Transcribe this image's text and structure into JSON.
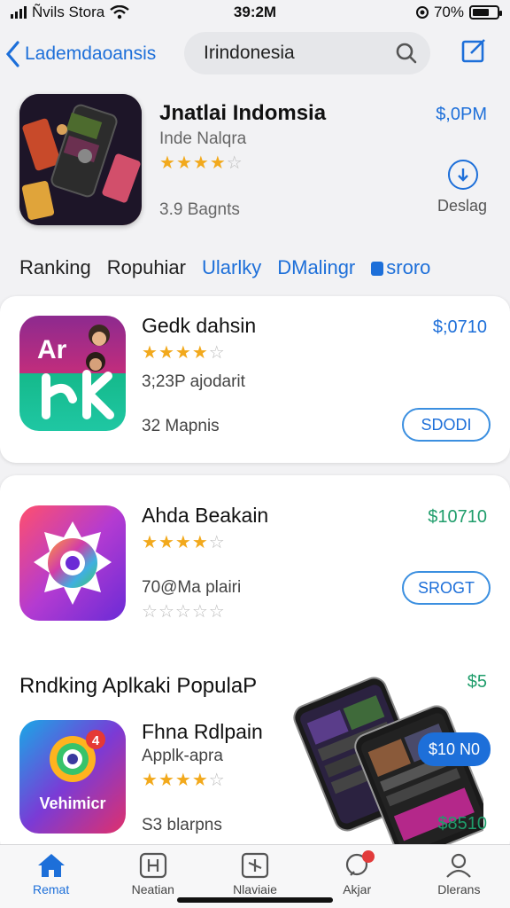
{
  "status_bar": {
    "carrier": "Ñvils Stora",
    "time": "39:2M",
    "battery": "70%",
    "battery_level": 0.7
  },
  "nav": {
    "back_label": "Lademdaoansis",
    "search_value": "Irindonesia"
  },
  "featured": {
    "title": "Jnatlai Indomsia",
    "subtitle": "Inde Nalqra",
    "rating": 3.5,
    "count": "3.9 Bagnts",
    "price": "$,0PM",
    "action_label": "Deslag"
  },
  "tabs": [
    "Ranking",
    "Ropuhiar",
    "Ularlky",
    "DMalingr",
    "sroro"
  ],
  "apps": [
    {
      "title": "Gedk dahsin",
      "rating": 4,
      "reviews": "3;23P ajodarit",
      "downloads": "32 Mapnis",
      "price": "$;0710",
      "button": "SDODI"
    },
    {
      "title": "Ahda Beakain",
      "rating": 4,
      "reviews": "70@Ma plairi",
      "rating2": 0,
      "price": "$10710",
      "button": "SROGT"
    }
  ],
  "section": {
    "title": "Rndking Aplkaki PopulaP",
    "price": "$5"
  },
  "bottom_app": {
    "title": "Fhna Rdlpain",
    "subtitle": "Applk-apra",
    "rating": 4,
    "downloads": "S3 blarpns",
    "price": "$8510",
    "badge_price": "$10 N0",
    "icon_label": "Vehimicr",
    "icon_badge": "4"
  },
  "tabbar": [
    {
      "label": "Remat",
      "icon": "home-icon",
      "active": true
    },
    {
      "label": "Neatian",
      "icon": "apps-icon",
      "active": false
    },
    {
      "label": "Nlaviaie",
      "icon": "star-box-icon",
      "active": false
    },
    {
      "label": "Akjar",
      "icon": "notification-icon",
      "active": false,
      "badge": true
    },
    {
      "label": "Dlerans",
      "icon": "person-icon",
      "active": false
    }
  ],
  "colors": {
    "accent": "#1d6fd9",
    "price_green": "#1f9d6b",
    "star": "#f2a91c"
  }
}
